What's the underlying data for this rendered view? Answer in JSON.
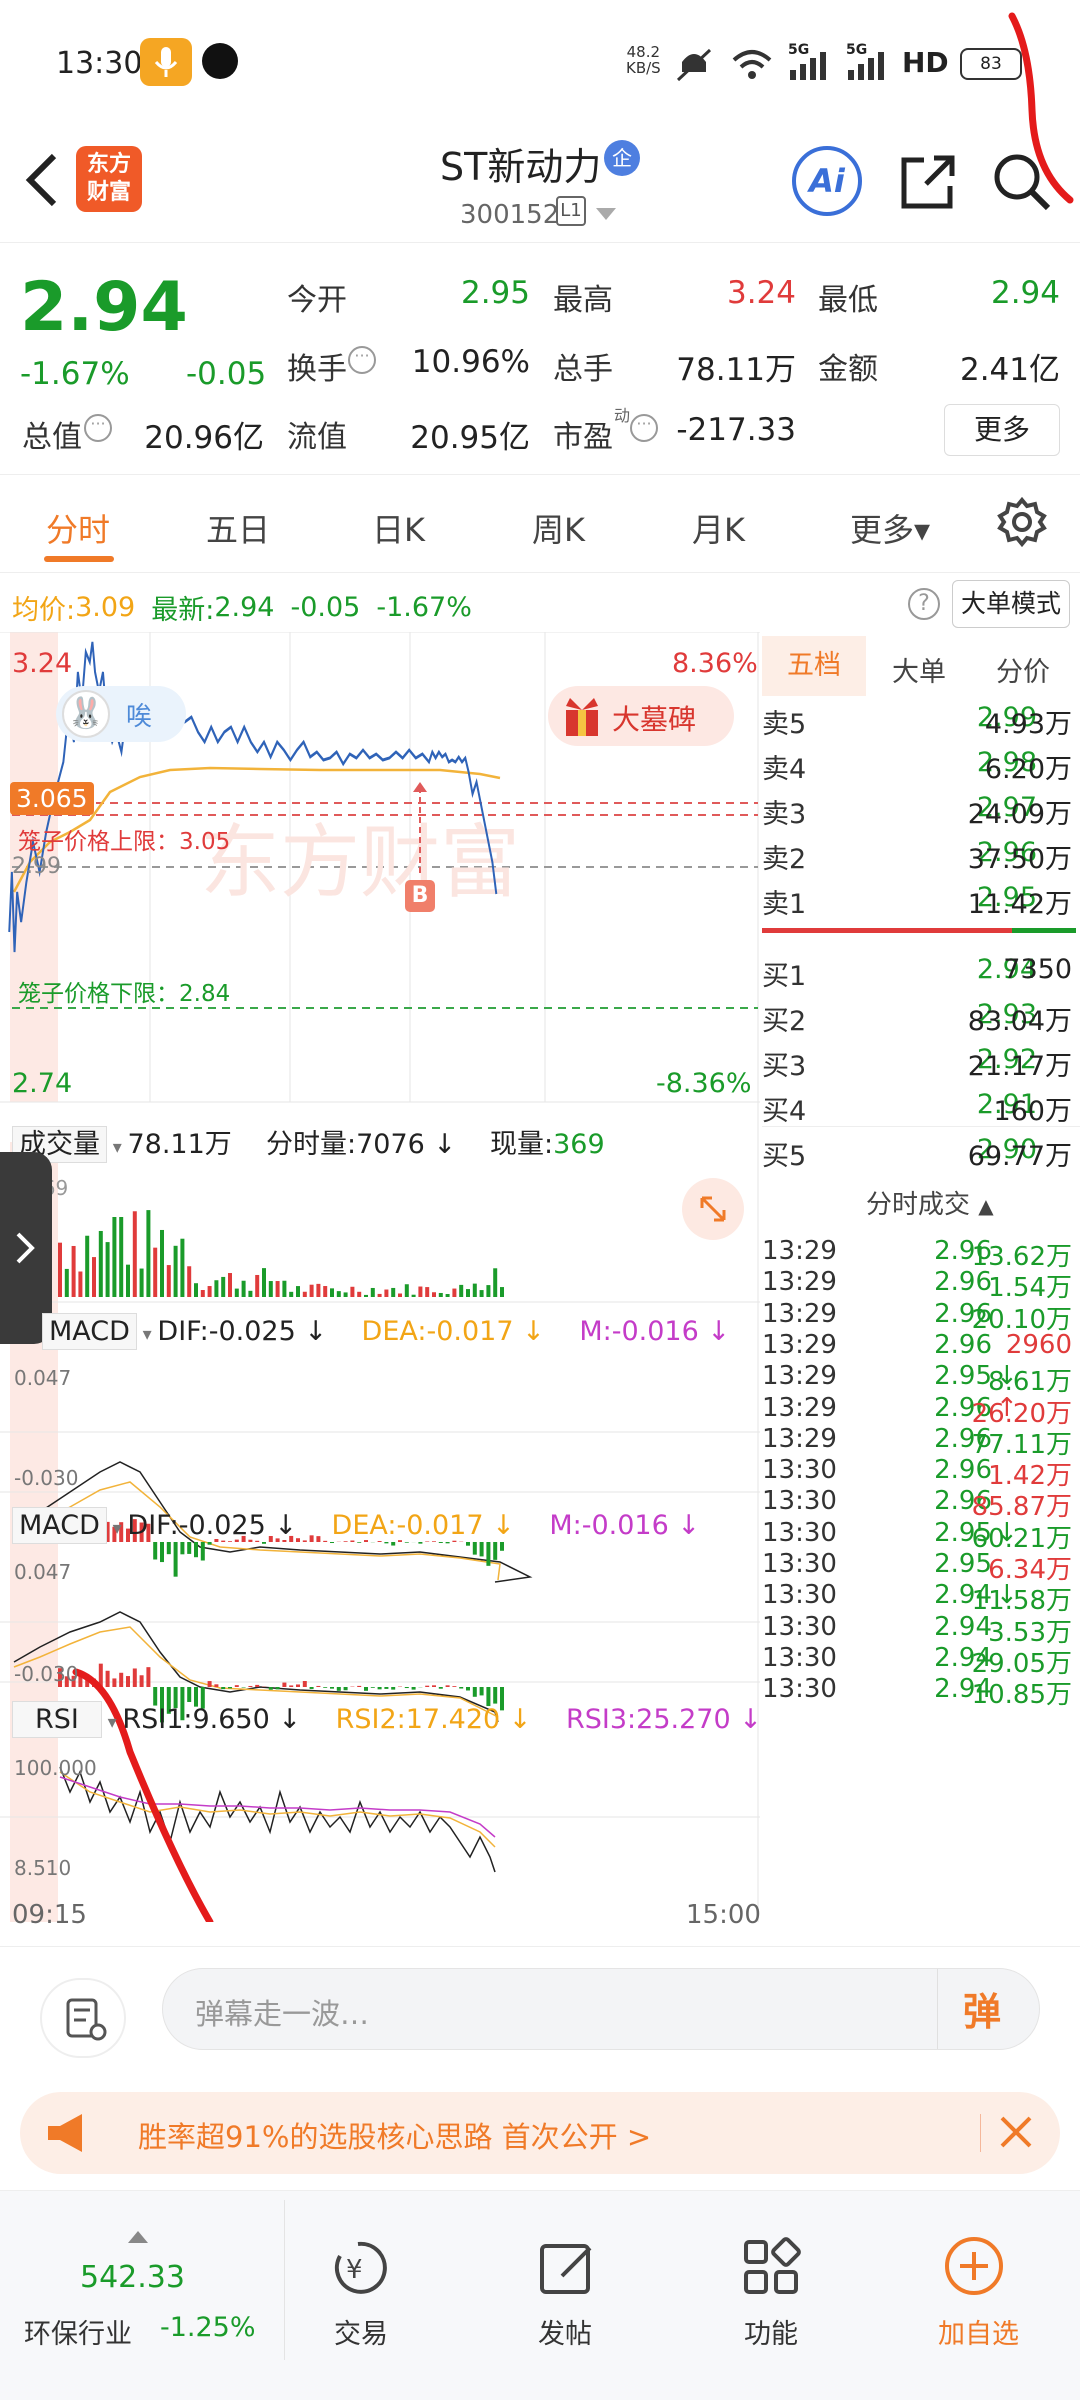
{
  "status_bar": {
    "time": "13:30",
    "net_speed_top": "48.2",
    "net_speed_bottom": "KB/S",
    "signal1": "5G",
    "signal2": "5G",
    "hd": "HD",
    "battery": "83"
  },
  "header": {
    "title": "ST新动力",
    "code": "300152",
    "level": "L1",
    "badge": "企",
    "app_logo_line1": "东方",
    "app_logo_line2": "财富",
    "ai_label": "Ai"
  },
  "quote": {
    "price": "2.94",
    "change_pct": "-1.67%",
    "change": "-0.05",
    "open_label": "今开",
    "open": "2.95",
    "high_label": "最高",
    "high": "3.24",
    "low_label": "最低",
    "low": "2.94",
    "turnover_label": "换手",
    "turnover": "10.96%",
    "volume_label": "总手",
    "volume": "78.11万",
    "amount_label": "金额",
    "amount": "2.41亿",
    "mktcap_label": "总值",
    "mktcap": "20.96亿",
    "float_label": "流值",
    "float": "20.95亿",
    "pe_label": "市盈",
    "pe_sup": "动",
    "pe": "-217.33",
    "more_label": "更多"
  },
  "tabs": [
    "分时",
    "五日",
    "日K",
    "周K",
    "月K",
    "更多▾"
  ],
  "active_tab": "分时",
  "info_line": {
    "avg_label": "均价:",
    "avg": "3.09",
    "last_label": "最新:",
    "last": "2.94",
    "chg": "-0.05",
    "pct": "-1.67%",
    "help": "?",
    "big_order": "大单模式"
  },
  "chart": {
    "top_price": "3.24",
    "top_pct": "8.36%",
    "bottom_price": "2.74",
    "bottom_pct": "-8.36%",
    "ref_price": "3.065",
    "mid_label": "2.99",
    "upper_limit_label": "笼子价格上限：3.05",
    "lower_limit_label": "笼子价格下限：2.84",
    "mascot_text": "唉",
    "tag_text": "大墓碑",
    "marker": "B",
    "time_start": "09:15",
    "time_end": "15:00"
  },
  "volume_bar": {
    "label": "成交量",
    "total": "78.11万",
    "tick_label": "分时量:7076 ↓",
    "cur_label": "现量:",
    "cur": "369",
    "axis": "369"
  },
  "macd1": {
    "label": "MACD",
    "dif": "DIF:-0.025 ↓",
    "dea": "DEA:-0.017 ↓",
    "m": "M:-0.016 ↓",
    "max": "0.047",
    "min": "-0.030"
  },
  "macd2": {
    "label": "MACD",
    "dif": "DIF:-0.025 ↓",
    "dea": "DEA:-0.017 ↓",
    "m": "M:-0.016 ↓",
    "max": "0.047",
    "min": "-0.030"
  },
  "rsi": {
    "label": "RSI",
    "rsi1": "RSI1:9.650 ↓",
    "rsi2": "RSI2:17.420 ↓",
    "rsi3": "RSI3:25.270 ↓",
    "max": "100.000",
    "min": "8.510"
  },
  "order_book": {
    "tabs": [
      "五档",
      "大单",
      "分价"
    ],
    "asks": [
      {
        "l": "卖5",
        "p": "2.99",
        "v": "4.93万"
      },
      {
        "l": "卖4",
        "p": "2.98",
        "v": "6.20万"
      },
      {
        "l": "卖3",
        "p": "2.97",
        "v": "24.09万"
      },
      {
        "l": "卖2",
        "p": "2.96",
        "v": "37.50万"
      },
      {
        "l": "卖1",
        "p": "2.95",
        "v": "11.42万"
      }
    ],
    "bids": [
      {
        "l": "买1",
        "p": "2.94",
        "v": "7350"
      },
      {
        "l": "买2",
        "p": "2.93",
        "v": "83.04万"
      },
      {
        "l": "买3",
        "p": "2.92",
        "v": "21.17万"
      },
      {
        "l": "买4",
        "p": "2.91",
        "v": "160万"
      },
      {
        "l": "买5",
        "p": "2.90",
        "v": "69.77万"
      }
    ]
  },
  "trades_title": "分时成交",
  "trades": [
    {
      "t": "13:29",
      "p": "2.96",
      "a": "",
      "v": "13.62万",
      "c": "green"
    },
    {
      "t": "13:29",
      "p": "2.96",
      "a": "",
      "v": "1.54万",
      "c": "green"
    },
    {
      "t": "13:29",
      "p": "2.96",
      "a": "",
      "v": "20.10万",
      "c": "green"
    },
    {
      "t": "13:29",
      "p": "2.96",
      "a": "",
      "v": "2960",
      "c": "red"
    },
    {
      "t": "13:29",
      "p": "2.95",
      "a": "↓",
      "v": "8.61万",
      "c": "green"
    },
    {
      "t": "13:29",
      "p": "2.96",
      "a": "↑",
      "v": "26.20万",
      "c": "red"
    },
    {
      "t": "13:29",
      "p": "2.96",
      "a": "",
      "v": "77.11万",
      "c": "green"
    },
    {
      "t": "13:30",
      "p": "2.96",
      "a": "",
      "v": "1.42万",
      "c": "red"
    },
    {
      "t": "13:30",
      "p": "2.96",
      "a": "",
      "v": "85.87万",
      "c": "red"
    },
    {
      "t": "13:30",
      "p": "2.95",
      "a": "↓",
      "v": "60.21万",
      "c": "green"
    },
    {
      "t": "13:30",
      "p": "2.95",
      "a": "",
      "v": "6.34万",
      "c": "red"
    },
    {
      "t": "13:30",
      "p": "2.94",
      "a": "↓",
      "v": "11.58万",
      "c": "green"
    },
    {
      "t": "13:30",
      "p": "2.94",
      "a": "",
      "v": "3.53万",
      "c": "green"
    },
    {
      "t": "13:30",
      "p": "2.94",
      "a": "",
      "v": "29.05万",
      "c": "green"
    },
    {
      "t": "13:30",
      "p": "2.94",
      "a": "",
      "v": "10.85万",
      "c": "green"
    }
  ],
  "comment": {
    "placeholder": "弹幕走一波…",
    "send": "弹"
  },
  "banner": {
    "text": "胜率超91%的选股核心思路 首次公开 >"
  },
  "bottom": {
    "index_value": "542.33",
    "index_name": "环保行业",
    "index_pct": "-1.25%",
    "trade": "交易",
    "post": "发帖",
    "func": "功能",
    "add": "加自选"
  },
  "colors": {
    "up": "#e03b3b",
    "down": "#1a9b2a",
    "accent": "#f07a28",
    "avg": "#f2a516"
  }
}
